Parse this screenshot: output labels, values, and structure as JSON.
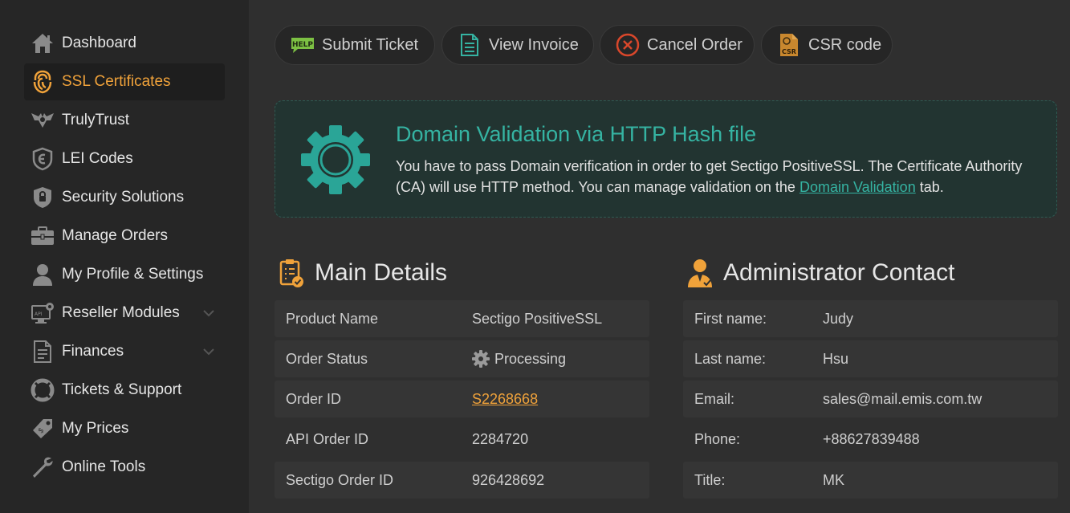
{
  "sidebar": {
    "items": [
      {
        "label": "Dashboard",
        "icon": "home-icon"
      },
      {
        "label": "SSL Certificates",
        "icon": "ssl-certificate-icon",
        "active": true
      },
      {
        "label": "TrulyTrust",
        "icon": "trulytrust-icon"
      },
      {
        "label": "LEI Codes",
        "icon": "lei-shield-icon"
      },
      {
        "label": "Security Solutions",
        "icon": "security-shield-icon"
      },
      {
        "label": "Manage Orders",
        "icon": "briefcase-icon"
      },
      {
        "label": "My Profile & Settings",
        "icon": "user-icon"
      },
      {
        "label": "Reseller Modules",
        "icon": "api-monitor-icon",
        "expandable": true
      },
      {
        "label": "Finances",
        "icon": "document-icon",
        "expandable": true
      },
      {
        "label": "Tickets & Support",
        "icon": "lifebuoy-icon"
      },
      {
        "label": "My Prices",
        "icon": "price-tag-icon"
      },
      {
        "label": "Online Tools",
        "icon": "wrench-icon"
      }
    ]
  },
  "toolbar": {
    "submit_ticket": "Submit Ticket",
    "help_badge": "HELP",
    "view_invoice": "View Invoice",
    "cancel_order": "Cancel Order",
    "csr_code": "CSR code",
    "csr_badge": "CSR"
  },
  "alert": {
    "title": "Domain Validation via HTTP Hash file",
    "text_before": "You have to pass Domain verification in order to get Sectigo PositiveSSL. The Certificate Authority (CA) will use HTTP method. You can manage validation on the ",
    "link": "Domain Validation",
    "text_after": " tab."
  },
  "main_details": {
    "title": "Main Details",
    "rows": [
      {
        "label": "Product Name",
        "value": "Sectigo PositiveSSL"
      },
      {
        "label": "Order Status",
        "value": "Processing"
      },
      {
        "label": "Order ID",
        "value": "S2268668"
      },
      {
        "label": "API Order ID",
        "value": "2284720"
      },
      {
        "label": "Sectigo Order ID",
        "value": "926428692"
      }
    ]
  },
  "admin_contact": {
    "title": "Administrator Contact",
    "rows": [
      {
        "label": "First name:",
        "value": "Judy"
      },
      {
        "label": "Last name:",
        "value": "Hsu"
      },
      {
        "label": "Email:",
        "value": "sales@mail.emis.com.tw"
      },
      {
        "label": "Phone:",
        "value": "+88627839488"
      },
      {
        "label": "Title:",
        "value": "MK"
      }
    ]
  },
  "colors": {
    "accent_orange": "#f0a23a",
    "teal": "#35b3a2",
    "cancel_red": "#d9472b",
    "help_green": "#7cc043"
  }
}
